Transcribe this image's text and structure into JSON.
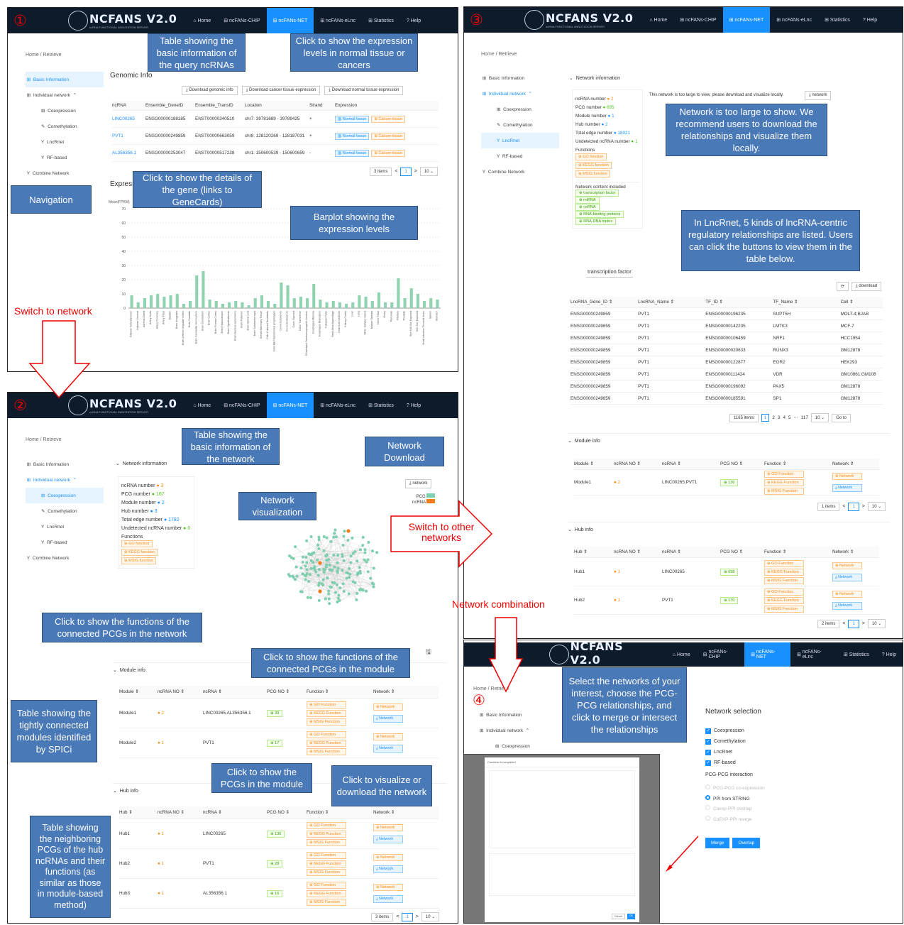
{
  "nav": {
    "logo": "NCFANS V2.0",
    "logo_sub": "ncRNA FUNCTIONAL ANNOTATION SERVER",
    "items": [
      "Home",
      "ncFANs-CHIP",
      "ncFANs-NET",
      "ncFANs-eLnc",
      "Statistics",
      "Help"
    ]
  },
  "panel_labels": [
    "①",
    "②",
    "③",
    "④"
  ],
  "breadcrumb": "Home / Retrieve",
  "sidebar": [
    "Basic Information",
    "Individual network",
    "Coexpression",
    "Comethylation",
    "LncRnet",
    "RF-based",
    "Combine Network"
  ],
  "p1": {
    "title": "Genomic Info",
    "buttons": [
      "Download genomic info",
      "Download cancer tissue expression",
      "Download normal tissue expression"
    ],
    "headers": [
      "ncRNA",
      "Ensemble_GeneID",
      "Ensemble_TransID",
      "Location",
      "Strand",
      "Expression"
    ],
    "rows": [
      [
        "LINC00265",
        "ENSG00000188185",
        "ENST00000340510",
        "chr7: 39781689 - 39789425",
        "+"
      ],
      [
        "PVT1",
        "ENSG00000249859",
        "ENST00000663059",
        "chr8: 128120269 - 128187031",
        "+"
      ],
      [
        "AL356356.1",
        "ENSG00000253047",
        "ENST00000517238",
        "chr1: 150600539 - 150600659",
        "-"
      ]
    ],
    "expr_tags": [
      "Normal tissue",
      "Cancer tissue"
    ],
    "pager": "3 items",
    "expr_title": "Express",
    "ylabel": "Mean(FPKM)",
    "callouts": [
      "Table showing the basic information of the query ncRNAs",
      "Click to show the expression levels in normal tissue or cancers",
      "Click to  show the details of the gene (links to GeneCards)",
      "Barplot showing the expression levels",
      "Navigation"
    ]
  },
  "chart_data": {
    "type": "bar",
    "title": "",
    "ylabel": "Mean(FPKM)",
    "ylim": [
      0,
      70
    ],
    "yticks": [
      0,
      10,
      20,
      30,
      40,
      50,
      60,
      70
    ],
    "categories": [
      "Adipose Subcutaneous",
      "Adipose Visceral",
      "Adrenal Gland",
      "Artery Aorta",
      "Artery Coronary",
      "Artery Tibial",
      "Bladder",
      "Brain Amygdala",
      "Brain Anterior cingulate cortex",
      "Brain Caudate",
      "Brain Cerebellar Hemisphere",
      "Brain Cerebellum",
      "Brain Cortex",
      "Brain Frontal Cortex",
      "Brain Hippocampus",
      "Brain Hypothalamus",
      "Brain Nucleus accumbens",
      "Brain Putamen",
      "Brain Spinal cord",
      "Brain Substantia nigra",
      "Breast Mammary Tissue",
      "Cells Cultured fibroblasts",
      "Cells EBV-transformed lymphocytes",
      "Cervix Ectocervix",
      "Cervix Endocervix",
      "Colon Sigmoid",
      "Colon Transverse",
      "Esophagus Gastroesophageal Junction",
      "Esophagus Mucosa",
      "Esophagus Muscularis",
      "Fallopian Tube",
      "Heart Atrial Appendage",
      "Heart Left Ventricle",
      "Kidney Cortex",
      "Liver",
      "Lung",
      "Minor Salivary Gland",
      "Muscle Skeletal",
      "Nerve Tibial",
      "Ovary",
      "Pancreas",
      "Pituitary",
      "Prostate",
      "Skin Not Sun Exposed",
      "Skin Sun Exposed",
      "Small Intestine Terminal Ileum",
      "Spleen",
      "Stomach"
    ],
    "values": [
      9,
      4,
      7,
      9,
      10,
      8,
      9,
      10,
      3,
      5,
      23,
      26,
      6,
      5,
      3,
      4,
      5,
      4,
      2,
      7,
      9,
      5,
      3,
      18,
      16,
      7,
      8,
      7,
      17,
      6,
      4,
      5,
      4,
      3,
      4,
      9,
      8,
      5,
      11,
      4,
      4,
      21,
      7,
      14,
      10,
      5,
      7,
      6
    ]
  },
  "p2": {
    "ni_title": "Network information",
    "stats": [
      [
        "ncRNA number",
        "3"
      ],
      [
        "PCG number",
        "167"
      ],
      [
        "Module number",
        "2"
      ],
      [
        "Hub number",
        "3"
      ],
      [
        "Total edge number",
        "1782"
      ],
      [
        "Undetected ncRNA number",
        "0"
      ]
    ],
    "functions_label": "Functions",
    "func_tags": [
      "GO function",
      "KEGG function",
      "MSIG function"
    ],
    "dl_btn": "network",
    "legend": [
      "PCG",
      "ncRNA"
    ],
    "module_title": "Module info",
    "mod_headers": [
      "Module",
      "ncRNA NO",
      "ncRNA",
      "PCG NO",
      "Function",
      "Network"
    ],
    "modules": [
      [
        "Module1",
        "2",
        "LINC00265,AL356356.1",
        "39"
      ],
      [
        "Module2",
        "1",
        "PVT1",
        "17"
      ]
    ],
    "func3": [
      "GO Function",
      "KEGG Function",
      "MSIG Function"
    ],
    "net_btns": [
      "Network",
      "Network"
    ],
    "hub_title": "Hub info",
    "hub_headers": [
      "Hub",
      "ncRNA NO",
      "ncRNA",
      "PCG NO",
      "Function",
      "Network"
    ],
    "hubs": [
      [
        "Hub1",
        "1",
        "LINC00265",
        "136"
      ],
      [
        "Hub2",
        "1",
        "PVT1",
        "28"
      ],
      [
        "Hub3",
        "1",
        "AL356356.1",
        "16"
      ]
    ],
    "pager": "3 items",
    "callouts": [
      "Table showing the basic information of the network",
      "Network Download",
      "Network visualization",
      "Click to show the functions of the connected PCGs in the network",
      "Click to show the functions of the connected PCGs in the module",
      "Table showing the tightly connected modules identified by SPICi",
      "Click to show the PCGs in the module",
      "Click to visualize or download the network",
      "Table showing the neighboring PCGs of the hub ncRNAs and their functions (as similar as those in module-based method)"
    ]
  },
  "p3": {
    "ni_title": "Network information",
    "stats": [
      [
        "ncRNA number",
        "2"
      ],
      [
        "PCG number",
        "695"
      ],
      [
        "Module number",
        "1"
      ],
      [
        "Hub number",
        "2"
      ],
      [
        "Total edge number",
        "18021"
      ],
      [
        "Undetected ncRNA number",
        "1"
      ]
    ],
    "large_msg": "This network is too large to view, please download and visualize locally.",
    "functions_label": "Functions",
    "func_tags": [
      "GO function",
      "KEGG function",
      "MSIG function"
    ],
    "content_label": "Network content included",
    "content_tags": [
      "transcription factor",
      "miRNA",
      "ceRNA",
      "RNA-binding proteins",
      "RNA-DNA triplex"
    ],
    "tab": "transcription factor",
    "download": "download",
    "tf_headers": [
      "LncRNA_Gene_ID",
      "LncRNA_Name",
      "TF_ID",
      "TF_Name",
      "Cell"
    ],
    "tf_rows": [
      [
        "ENSG00000249859",
        "PVT1",
        "ENSG00000196235",
        "SUPT5H",
        "MOLT-4;BJAB"
      ],
      [
        "ENSG00000249859",
        "PVT1",
        "ENSG00000142235",
        "LMTK3",
        "MCF-7"
      ],
      [
        "ENSG00000249859",
        "PVT1",
        "ENSG00000106459",
        "NRF1",
        "HCC1954"
      ],
      [
        "ENSG00000249859",
        "PVT1",
        "ENSG00000020633",
        "RUNX3",
        "GM12878"
      ],
      [
        "ENSG00000249859",
        "PVT1",
        "ENSG00000122877",
        "EGR2",
        "HEK293"
      ],
      [
        "ENSG00000249859",
        "PVT1",
        "ENSG00000111424",
        "VDR",
        "GM10861;GM108"
      ],
      [
        "ENSG00000249859",
        "PVT1",
        "ENSG00000196092",
        "PAX5",
        "GM12878"
      ],
      [
        "ENSG00000249859",
        "PVT1",
        "ENSG00000185591",
        "SP1",
        "GM12878"
      ]
    ],
    "tf_pager": [
      "1165 items",
      "1",
      "2",
      "3",
      "4",
      "5",
      "···",
      "117",
      "10",
      "Go to"
    ],
    "module_title": "Module info",
    "mod_headers": [
      "Module",
      "ncRNA NO",
      "ncRNA",
      "PCG NO",
      "Function",
      "Network"
    ],
    "module": [
      "Module1",
      "2",
      "LINC00265,PVT1",
      "136"
    ],
    "hub_title": "Hub info",
    "hub_headers": [
      "Hub",
      "ncRNA NO",
      "ncRNA",
      "PCG NO",
      "Function",
      "Network"
    ],
    "hubs": [
      [
        "Hub1",
        "1",
        "LINC00265",
        "658"
      ],
      [
        "Hub2",
        "1",
        "PVT1",
        "170"
      ]
    ],
    "callouts": [
      "Network is too large to show. We recommend users to download the relationships and visualize them locally.",
      "In LncRnet, 5 kinds of lncRNA-centric regulatory relationships are listed. Users can click the buttons to view them  in the table below."
    ],
    "items1": "1 items",
    "items2": "2 items"
  },
  "p4": {
    "title": "Network selection",
    "checks": [
      "Coexpression",
      "Comethylation",
      "LncRnet",
      "RF-based"
    ],
    "pcg_label": "PCG-PCG interaction",
    "radios": [
      "PCG-PCG co-expression",
      "PPI from STRING",
      "Coexp-PPI overlap",
      "CoEXP-PPI merge"
    ],
    "buttons": [
      "Merge",
      "Overlap"
    ],
    "callout": "Select the networks of your interest, choose the PCG-PCG relationships, and click to merge or intersect the relationships",
    "dialog_title": "Combine is completed",
    "dialog_btns": [
      "Cancel",
      "OK"
    ]
  },
  "arrows": {
    "switch_network": "Switch to network",
    "switch_other": "Switch to other networks",
    "combination": "Network combination"
  },
  "colors": {
    "accent": "#1890ff",
    "nav_bg": "#0d1b2a",
    "callout": "#4a79b8",
    "pcg": "#7ecfae",
    "ncrna": "#f07d1a"
  }
}
